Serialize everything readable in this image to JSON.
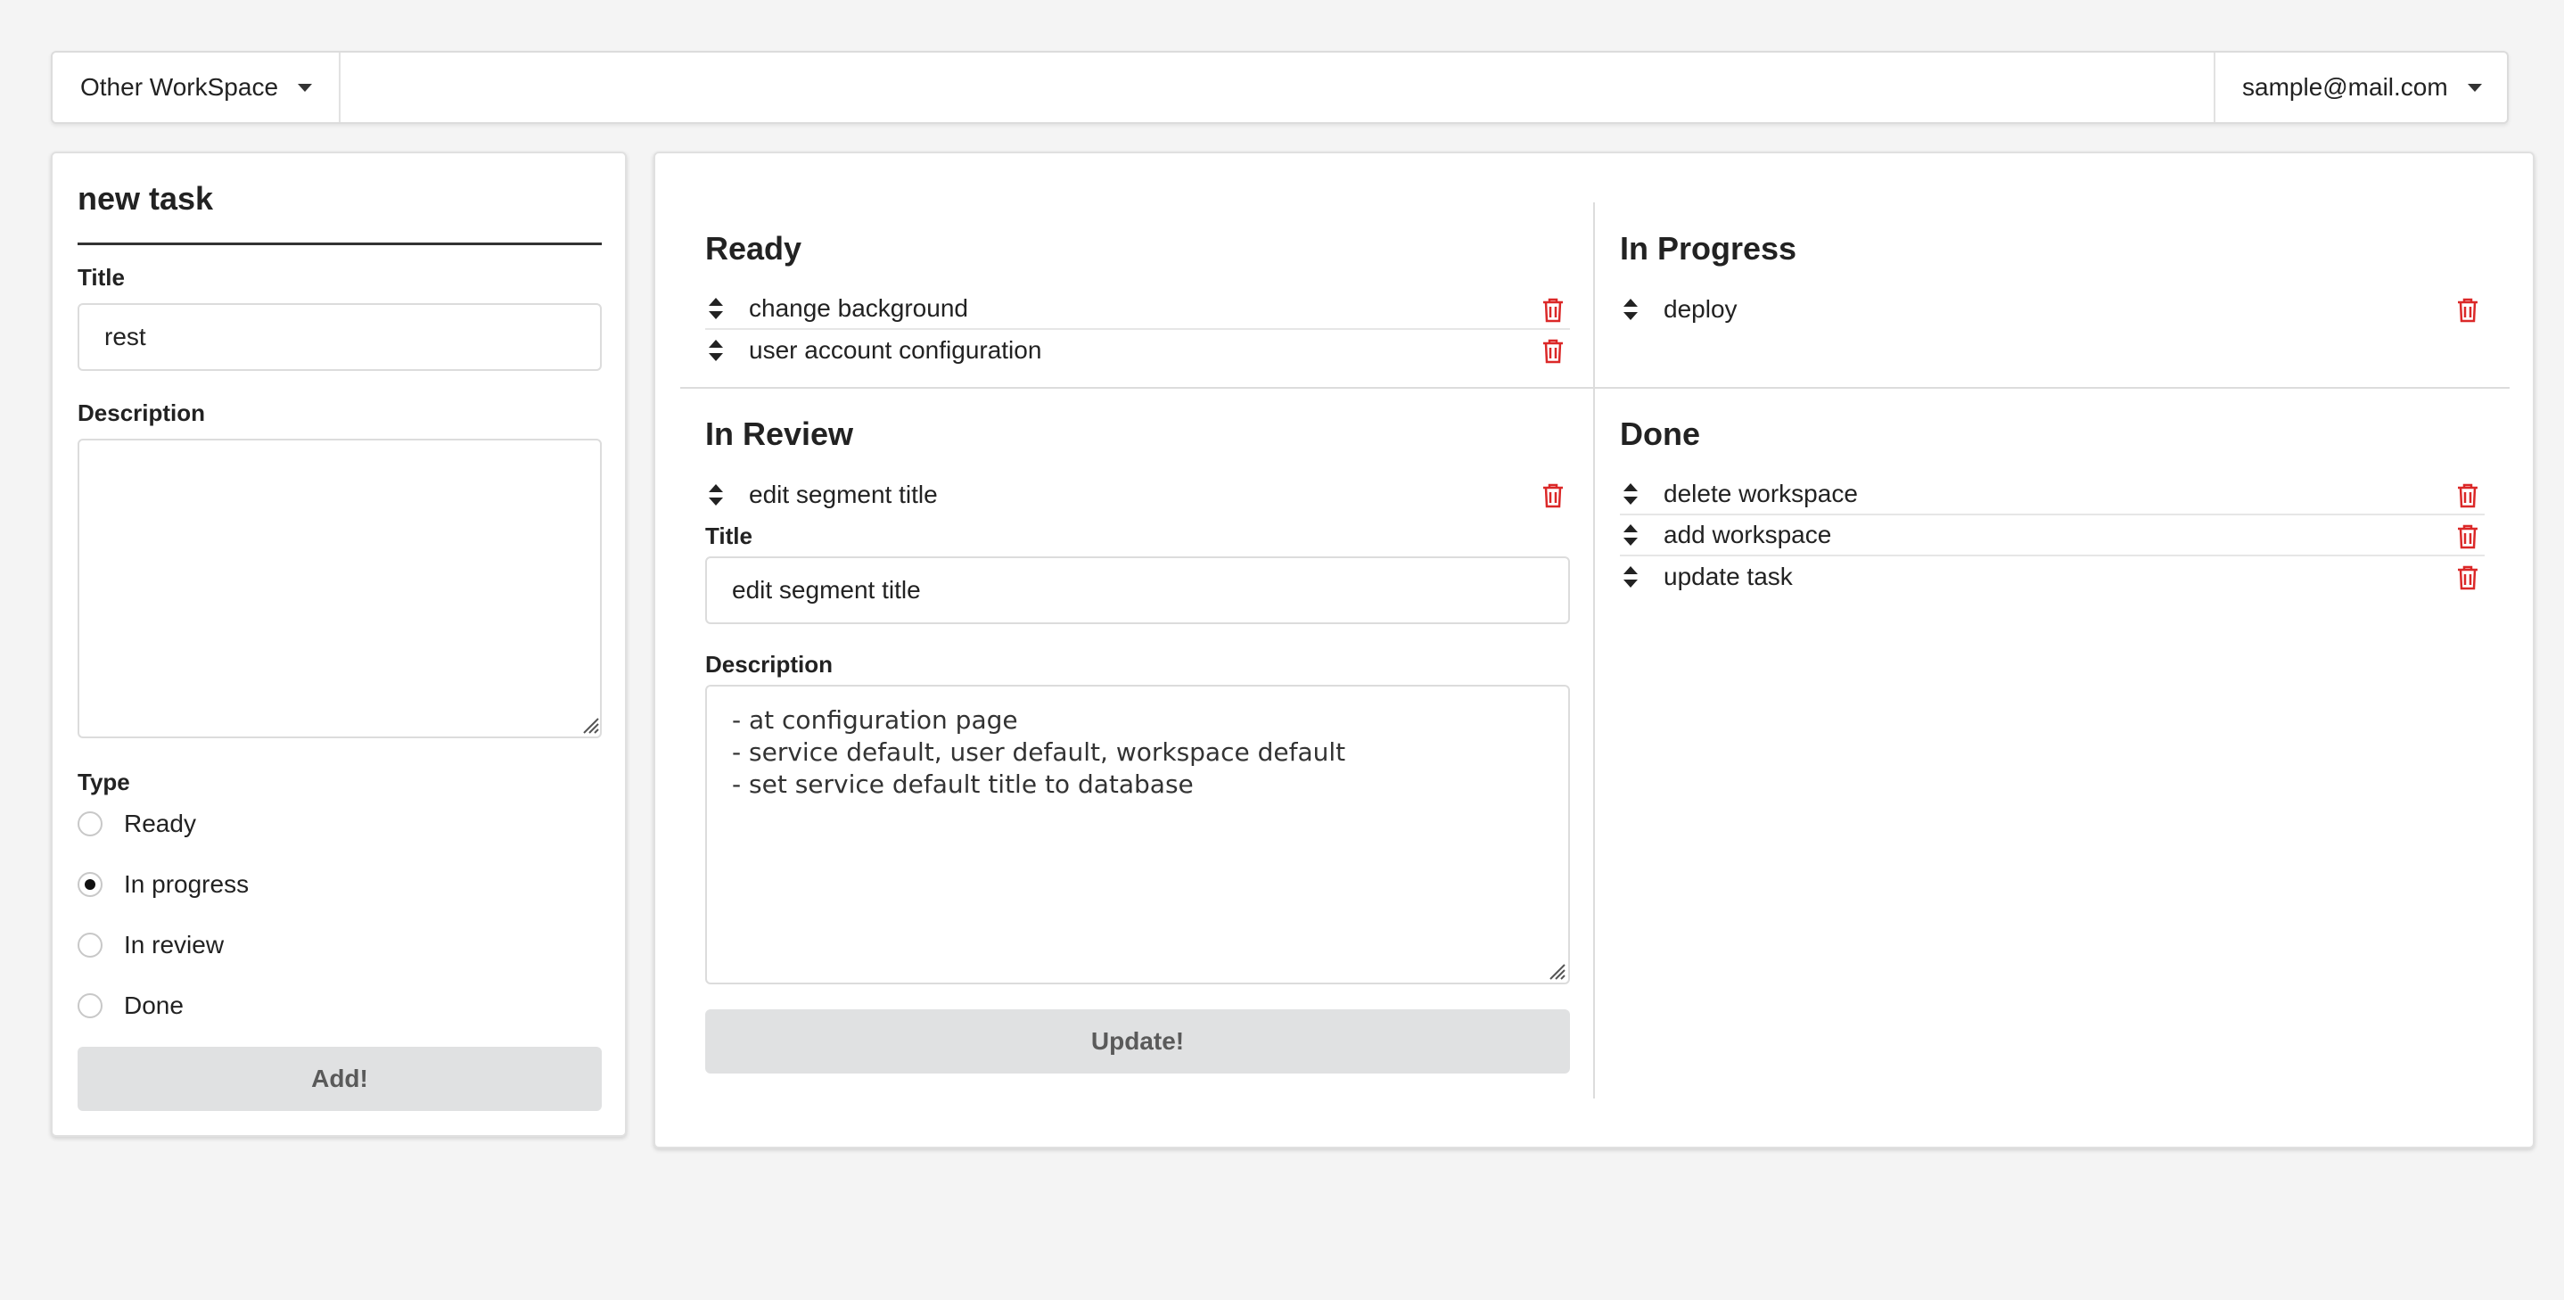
{
  "menubar": {
    "workspace_label": "Other WorkSpace",
    "user_label": "sample@mail.com"
  },
  "new_task": {
    "header": "new task",
    "title_label": "Title",
    "title_value": "rest",
    "description_label": "Description",
    "description_value": "",
    "type_label": "Type",
    "types": [
      "Ready",
      "In progress",
      "In review",
      "Done"
    ],
    "selected_type": "In progress",
    "add_label": "Add!"
  },
  "board": {
    "ready": {
      "title": "Ready",
      "tasks": [
        "change background",
        "user account configuration"
      ]
    },
    "in_progress": {
      "title": "In Progress",
      "tasks": [
        "deploy"
      ]
    },
    "in_review": {
      "title": "In Review",
      "tasks": [
        "edit segment title"
      ],
      "edit": {
        "title_label": "Title",
        "title_value": "edit segment title",
        "description_label": "Description",
        "description_value": "- at configuration page\n- service default, user default, workspace default\n- set service default title to database",
        "update_label": "Update!"
      }
    },
    "done": {
      "title": "Done",
      "tasks": [
        "delete workspace",
        "add workspace",
        "update task"
      ]
    }
  },
  "colors": {
    "trash": "#db2828",
    "button_bg": "#e0e1e2"
  }
}
